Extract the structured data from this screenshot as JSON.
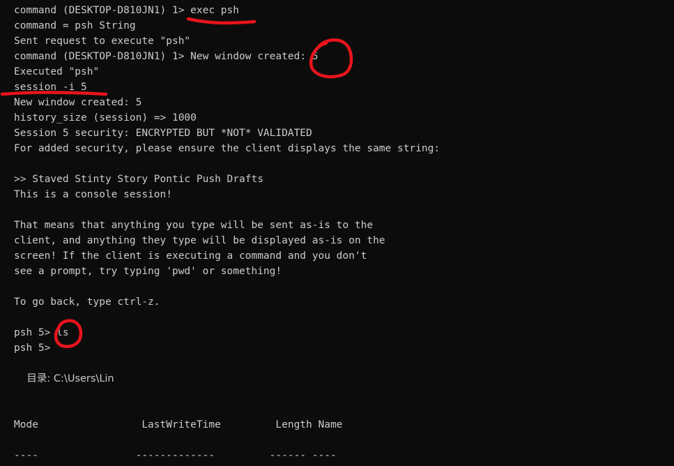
{
  "terminal": {
    "lines": [
      "command (DESKTOP-D810JN1) 1> exec psh",
      "command = psh String",
      "Sent request to execute \"psh\"",
      "command (DESKTOP-D810JN1) 1> New window created: 5",
      "Executed \"psh\"",
      "session -i 5",
      "New window created: 5",
      "history_size (session) => 1000",
      "Session 5 security: ENCRYPTED BUT *NOT* VALIDATED",
      "For added security, please ensure the client displays the same string:",
      "",
      ">> Staved Stinty Story Pontic Push Drafts",
      "This is a console session!",
      "",
      "That means that anything you type will be sent as-is to the",
      "client, and anything they type will be displayed as-is on the",
      "screen! If the client is executing a command and you don't",
      "see a prompt, try typing 'pwd' or something!",
      "",
      "To go back, type ctrl-z.",
      "",
      "psh 5> ls",
      "psh 5>",
      "",
      "    目录: C:\\Users\\Lin",
      "",
      "",
      "Mode                 LastWriteTime         Length Name",
      "",
      "----                -------------         ------ ----"
    ]
  },
  "annotation_color": "#e8141c"
}
